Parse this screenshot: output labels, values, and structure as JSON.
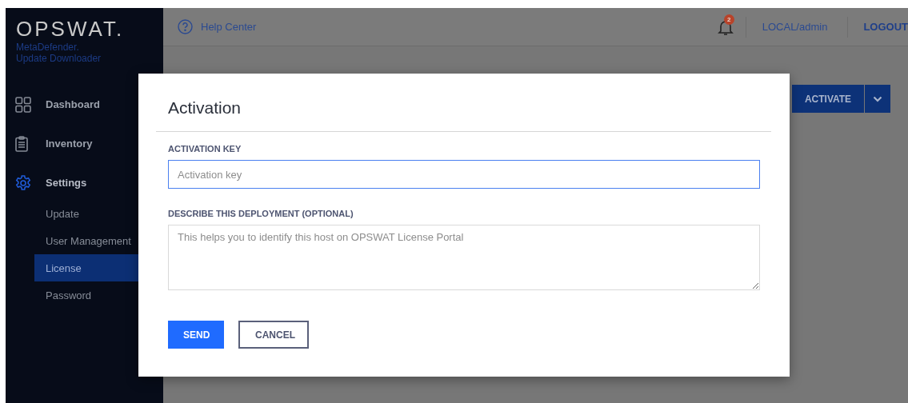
{
  "sidebar": {
    "logo": "OPSWAT.",
    "product": [
      "MetaDefender.",
      "Update Downloader"
    ],
    "items": [
      {
        "label": "Dashboard",
        "kind": "dashboard",
        "selected": false
      },
      {
        "label": "Inventory",
        "kind": "inventory",
        "selected": false
      },
      {
        "label": "Settings",
        "kind": "settings",
        "selected": true
      }
    ],
    "subitems": [
      {
        "label": "Update",
        "selected": false
      },
      {
        "label": "User Management",
        "selected": false
      },
      {
        "label": "License",
        "selected": true
      },
      {
        "label": "Password",
        "selected": false
      }
    ]
  },
  "header": {
    "help": "Help Center",
    "notification_count": "2",
    "user": "LOCAL/admin",
    "logout": "LOGOUT"
  },
  "page": {
    "activate_button": "ACTIVATE"
  },
  "dialog": {
    "title": "Activation",
    "fields": [
      {
        "label": "ACTIVATION KEY",
        "placeholder": "Activation key",
        "kind": "input",
        "focused": true
      },
      {
        "label": "DESCRIBE THIS DEPLOYMENT (OPTIONAL)",
        "placeholder": "This helps you to identify this host on OPSWAT License Portal",
        "kind": "textarea",
        "focused": false
      }
    ],
    "buttons": [
      {
        "label": "SEND",
        "kind": "primary"
      },
      {
        "label": "CANCEL",
        "kind": "secondary"
      }
    ]
  }
}
